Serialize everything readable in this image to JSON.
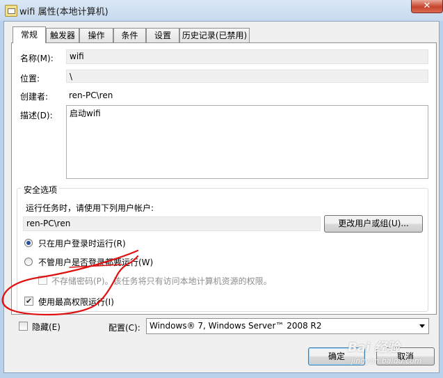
{
  "window": {
    "title": "wifi 属性(本地计算机)",
    "close_label": "✕"
  },
  "tabs": [
    {
      "label": "常规",
      "active": true
    },
    {
      "label": "触发器",
      "active": false
    },
    {
      "label": "操作",
      "active": false
    },
    {
      "label": "条件",
      "active": false
    },
    {
      "label": "设置",
      "active": false
    },
    {
      "label": "历史记录(已禁用)",
      "active": false
    }
  ],
  "general": {
    "name_label": "名称(M):",
    "name_value": "wifi",
    "location_label": "位置:",
    "location_value": "\\",
    "author_label": "创建者:",
    "author_value": "ren-PC\\ren",
    "description_label": "描述(D):",
    "description_value": "启动wifi"
  },
  "security": {
    "group_title": "安全选项",
    "run_as_label": "运行任务时，请使用下列用户帐户:",
    "run_as_value": "ren-PC\\ren",
    "change_user_button": "更改用户或组(U)...",
    "radio_logged_on": "只在用户登录时运行(R)",
    "radio_logged_on_selected": true,
    "radio_whether_logged": "不管用户是否登录都要运行(W)",
    "radio_whether_logged_selected": false,
    "no_store_password": "不存储密码(P)。该任务将只有访问本地计算机资源的权限。",
    "no_store_password_checked": false,
    "highest_privileges": "使用最高权限运行(I)",
    "highest_privileges_checked": true
  },
  "footer": {
    "hidden_label": "隐藏(E)",
    "hidden_checked": false,
    "configure_label": "配置(C):",
    "configure_value": "Windows® 7, Windows Server™ 2008 R2",
    "ok_button": "确定",
    "cancel_button": "取消"
  },
  "watermark": {
    "text": "Bai 经验",
    "url": "jingyan.baidu.com"
  },
  "colors": {
    "radio_dot": "#2a4e9a",
    "annotation_red": "#e01010",
    "title_bar": "#c6d9ee"
  }
}
